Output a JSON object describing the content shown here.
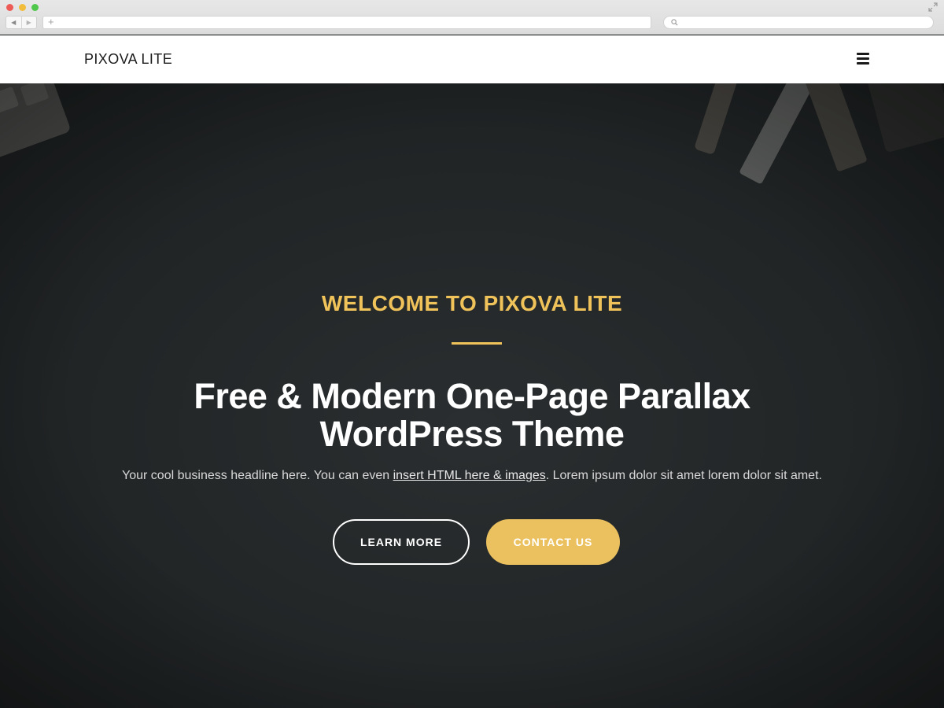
{
  "browser": {
    "back_label": "◀",
    "forward_label": "▶",
    "new_tab_label": "+"
  },
  "header": {
    "logo": "PIXOVA LITE",
    "menu_icon": "hamburger-menu-icon"
  },
  "hero": {
    "kicker": "WELCOME TO PIXOVA LITE",
    "headline_line1": "Free & Modern One-Page Parallax",
    "headline_line2": "WordPress Theme",
    "subline_before": "Your cool business headline here. You can even ",
    "subline_link": "insert HTML here & images",
    "subline_after": ". Lorem ipsum dolor sit amet lorem dolor sit amet.",
    "buttons": {
      "learn_more": "LEARN MORE",
      "contact_us": "CONTACT US"
    }
  },
  "colors": {
    "accent": "#f0c35a",
    "button_fill": "#ebc15f",
    "hero_background": "#222627",
    "header_background": "#ffffff"
  }
}
